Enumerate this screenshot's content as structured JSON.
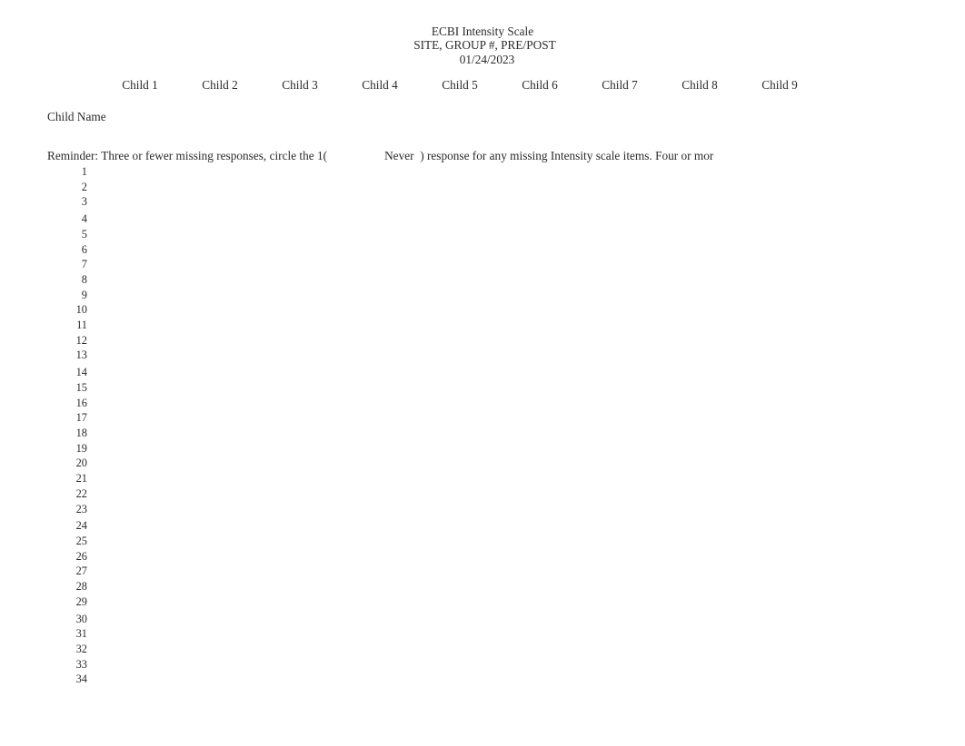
{
  "document": {
    "title_lines": [
      "ECBI Intensity Scale",
      "SITE, GROUP #, PRE/POST",
      "01/24/2023"
    ],
    "text_color": "#2b2b2b",
    "background_color": "#ffffff"
  },
  "header_row": {
    "row_label": "Child Name",
    "columns": [
      "Child 1",
      "Child 2",
      "Child 3",
      "Child 4",
      "Child 5",
      "Child 6",
      "Child 7",
      "Child 8",
      "Child 9"
    ]
  },
  "reminder": {
    "segment_1": "Reminder: Three or fewer missing responses, circle the 1(",
    "segment_2": "Never  ) response for any missing Intensity scale items. Four or mor"
  },
  "items": [
    {
      "number": "1",
      "group_break": false
    },
    {
      "number": "2",
      "group_break": false
    },
    {
      "number": "3",
      "group_break": false
    },
    {
      "number": "4",
      "group_break": true
    },
    {
      "number": "5",
      "group_break": false
    },
    {
      "number": "6",
      "group_break": false
    },
    {
      "number": "7",
      "group_break": false
    },
    {
      "number": "8",
      "group_break": false
    },
    {
      "number": "9",
      "group_break": false
    },
    {
      "number": "10",
      "group_break": false
    },
    {
      "number": "11",
      "group_break": false
    },
    {
      "number": "12",
      "group_break": false
    },
    {
      "number": "13",
      "group_break": false
    },
    {
      "number": "14",
      "group_break": true
    },
    {
      "number": "15",
      "group_break": false
    },
    {
      "number": "16",
      "group_break": false
    },
    {
      "number": "17",
      "group_break": false
    },
    {
      "number": "18",
      "group_break": false
    },
    {
      "number": "19",
      "group_break": false
    },
    {
      "number": "20",
      "group_break": false
    },
    {
      "number": "21",
      "group_break": false
    },
    {
      "number": "22",
      "group_break": false
    },
    {
      "number": "23",
      "group_break": false
    },
    {
      "number": "24",
      "group_break": true
    },
    {
      "number": "25",
      "group_break": false
    },
    {
      "number": "26",
      "group_break": false
    },
    {
      "number": "27",
      "group_break": false
    },
    {
      "number": "28",
      "group_break": false
    },
    {
      "number": "29",
      "group_break": false
    },
    {
      "number": "30",
      "group_break": true
    },
    {
      "number": "31",
      "group_break": false
    },
    {
      "number": "32",
      "group_break": false
    },
    {
      "number": "33",
      "group_break": false
    },
    {
      "number": "34",
      "group_break": false
    }
  ]
}
